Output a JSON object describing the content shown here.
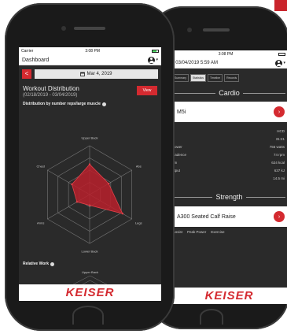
{
  "front": {
    "status": {
      "carrier": "Carrier",
      "time": "3:08 PM"
    },
    "header": {
      "title": "Dashboard",
      "caret": "▾"
    },
    "datebar": {
      "back": "<",
      "date": "Mar 4, 2019",
      "calendar_icon": "calendar-icon"
    },
    "workout": {
      "title": "Workout Distribution",
      "range": "(02/18/2019 - 03/04/2019)",
      "view_label": "View"
    },
    "distribution_heading": "Distribution by number reps/large muscle",
    "radar": {
      "axes": [
        "Upper Back",
        "Abs",
        "Legs",
        "Lower Back",
        "Arms",
        "Chest"
      ],
      "values": [
        0.62,
        0.45,
        0.78,
        0.22,
        0.3,
        0.42
      ],
      "levels": 4,
      "fill_color": "#b8202b"
    },
    "relative_heading": "Relative Work",
    "relative_axis_top": "Upper Back",
    "brand": "KEISER"
  },
  "back": {
    "status": {
      "time": "3:08 PM"
    },
    "header": {
      "title": "| 03/04/2019 5:59 AM",
      "caret": "▾"
    },
    "tabs": [
      "Summary",
      "Statistics",
      "Timeline",
      "Records"
    ],
    "active_tab": 1,
    "cardio": {
      "heading": "Cardio",
      "card_label": "M5i",
      "stats": [
        {
          "label": "",
          "value": "HCD"
        },
        {
          "label": "",
          "value": "31:21"
        },
        {
          "label": "Power",
          "value": "756 watts"
        },
        {
          "label": "Cadence",
          "value": "74 rpm"
        },
        {
          "label": "um",
          "value": "624 kcal"
        },
        {
          "label": "utput",
          "value": "637 kJ"
        },
        {
          "label": "",
          "value": "14.5 mi"
        }
      ]
    },
    "strength": {
      "heading": "Strength",
      "card_label": "A300 Seated Calf Raise",
      "footer_labels": [
        "Assist",
        "Peak Power",
        "Exercise"
      ]
    },
    "brand": "KEISER"
  },
  "colors": {
    "accent": "#d42a30",
    "screen_bg": "#2a2a2a"
  }
}
